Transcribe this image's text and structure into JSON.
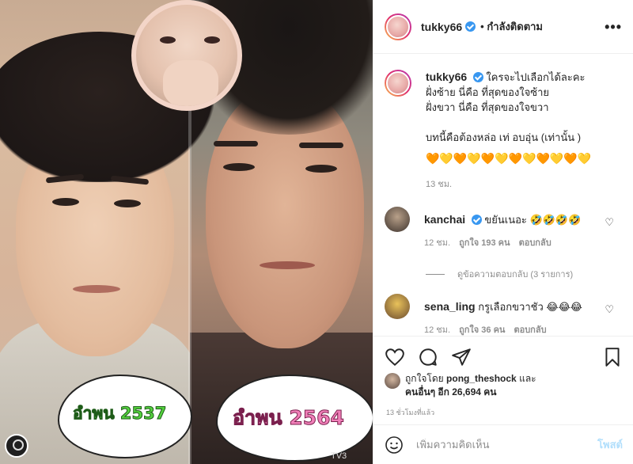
{
  "image": {
    "left_label": "อำพน 2537",
    "right_label": "อำพน 2564",
    "watermark": "TV3"
  },
  "header": {
    "username": "tukky66",
    "follow_status": "• กำลังติดตาม",
    "more_icon": "•••"
  },
  "caption": {
    "username": "tukky66",
    "lines": [
      "ใครจะไปเลือกได้ละคะ",
      "ฝั่งซ้าย นี่คือ ที่สุดของใจซ้าย",
      "ฝั่งขวา นี่คือ ที่สุดของใจขวา",
      "บทนี้คือต้องหล่อ เท่ อบอุ่น (เท่านั้น )"
    ],
    "hearts": "🧡💛🧡💛🧡💛🧡💛🧡💛🧡💛",
    "time": "13 ชม."
  },
  "comments": [
    {
      "username": "kanchai",
      "text": "ขยันเนอะ 🤣🤣🤣🤣",
      "time": "12 ชม.",
      "likes": "ถูกใจ 193 คน",
      "reply_label": "ตอบกลับ",
      "replies_label": "ดูข้อความตอบกลับ (3 รายการ)"
    },
    {
      "username": "sena_ling",
      "text": "กรูเลือกขวาชัว 😂😂😂",
      "time": "12 ชม.",
      "likes": "ถูกใจ 36 คน",
      "reply_label": "ตอบกลับ"
    }
  ],
  "likes": {
    "prefix": "ถูกใจโดย",
    "user": "pong_theshock",
    "and": "และ",
    "others": "คนอื่นๆ อีก 26,694 คน"
  },
  "post_time": "13 ชั่วโมงที่แล้ว",
  "comment_box": {
    "placeholder": "เพิ่มความคิดเห็น",
    "post_label": "โพสต์"
  },
  "colors": {
    "verified": "#3897f0",
    "post_button": "#b2dffc",
    "secondary_text": "#8e8e8e"
  }
}
